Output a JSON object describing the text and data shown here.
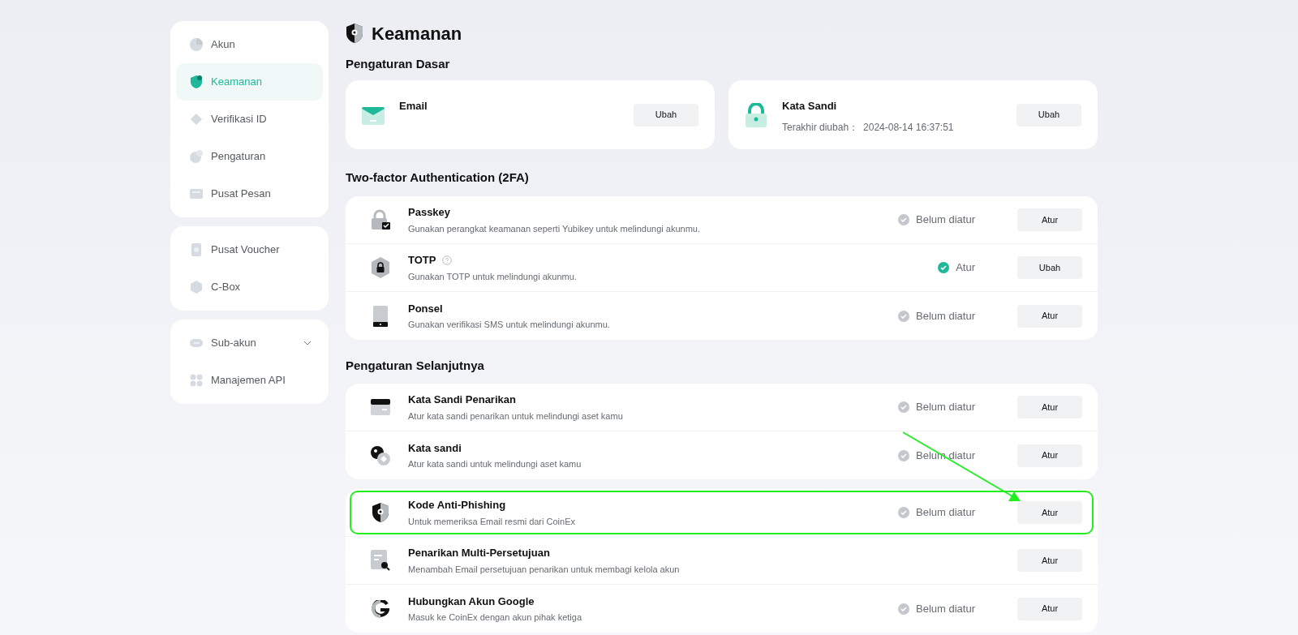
{
  "sidebar": {
    "groups": [
      {
        "items": [
          {
            "label": "Akun",
            "selected": false
          },
          {
            "label": "Keamanan",
            "selected": true
          },
          {
            "label": "Verifikasi ID",
            "selected": false
          },
          {
            "label": "Pengaturan",
            "selected": false
          },
          {
            "label": "Pusat Pesan",
            "selected": false
          }
        ]
      },
      {
        "items": [
          {
            "label": "Pusat Voucher",
            "selected": false
          },
          {
            "label": "C-Box",
            "selected": false
          }
        ]
      },
      {
        "items": [
          {
            "label": "Sub-akun",
            "selected": false,
            "expandable": true
          },
          {
            "label": "Manajemen API",
            "selected": false
          }
        ]
      }
    ]
  },
  "page_title": "Keamanan",
  "basic": {
    "heading": "Pengaturan Dasar",
    "cards": [
      {
        "title": "Email",
        "button": "Ubah"
      },
      {
        "title": "Kata Sandi",
        "detail_label": "Terakhir diubah：",
        "detail_value": "2024-08-14 16:37:51",
        "button": "Ubah"
      }
    ]
  },
  "sections": [
    {
      "heading": "Two-factor Authentication (2FA)",
      "cards": [
        [
          {
            "title": "Passkey",
            "description": "Gunakan perangkat keamanan seperti Yubikey untuk melindungi akunmu.",
            "status": {
              "text": "Belum diatur",
              "done": false
            },
            "button": "Atur",
            "highlighted": false
          },
          {
            "title": "TOTP",
            "help": true,
            "description": "Gunakan TOTP untuk melindungi akunmu.",
            "status": {
              "text": "Atur",
              "done": true
            },
            "button": "Ubah",
            "highlighted": false
          },
          {
            "title": "Ponsel",
            "description": "Gunakan verifikasi SMS untuk melindungi akunmu.",
            "status": {
              "text": "Belum diatur",
              "done": false
            },
            "button": "Atur",
            "highlighted": false
          }
        ]
      ]
    },
    {
      "heading": "Pengaturan Selanjutnya",
      "cards": [
        [
          {
            "title": "Kata Sandi Penarikan",
            "description": "Atur kata sandi penarikan untuk melindungi aset kamu",
            "status": {
              "text": "Belum diatur",
              "done": false
            },
            "button": "Atur",
            "highlighted": false
          },
          {
            "title": "Kata sandi",
            "description": "Atur kata sandi untuk melindungi aset kamu",
            "status": {
              "text": "Belum diatur",
              "done": false
            },
            "button": "Atur",
            "highlighted": false
          }
        ],
        [
          {
            "title": "Kode Anti-Phishing",
            "description": "Untuk memeriksa Email resmi dari CoinEx",
            "status": {
              "text": "Belum diatur",
              "done": false
            },
            "button": "Atur",
            "highlighted": true
          },
          {
            "title": "Penarikan Multi-Persetujuan",
            "description": "Menambah Email persetujuan penarikan untuk membagi kelola akun",
            "button": "Atur",
            "highlighted": false
          },
          {
            "title": "Hubungkan Akun Google",
            "description": "Masuk ke CoinEx dengan akun pihak ketiga",
            "status": {
              "text": "Belum diatur",
              "done": false
            },
            "button": "Atur",
            "highlighted": false
          }
        ]
      ]
    }
  ]
}
